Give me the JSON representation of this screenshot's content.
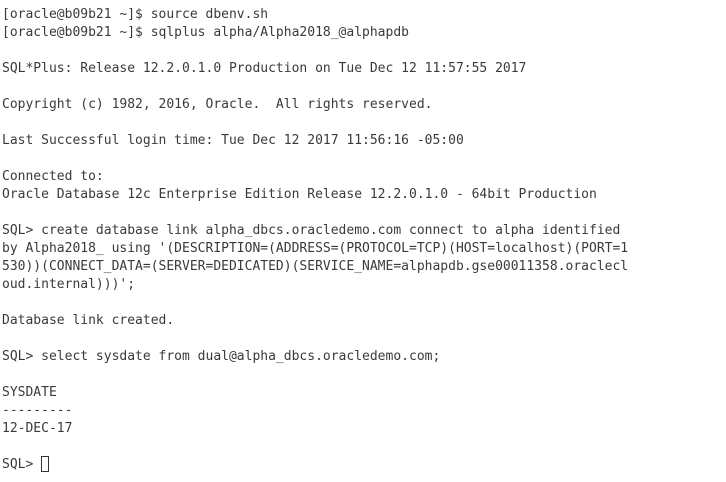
{
  "terminal": {
    "lines": [
      "[oracle@b09b21 ~]$ source dbenv.sh",
      "[oracle@b09b21 ~]$ sqlplus alpha/Alpha2018_@alphapdb",
      "",
      "SQL*Plus: Release 12.2.0.1.0 Production on Tue Dec 12 11:57:55 2017",
      "",
      "Copyright (c) 1982, 2016, Oracle.  All rights reserved.",
      "",
      "Last Successful login time: Tue Dec 12 2017 11:56:16 -05:00",
      "",
      "Connected to:",
      "Oracle Database 12c Enterprise Edition Release 12.2.0.1.0 - 64bit Production",
      "",
      "SQL> create database link alpha_dbcs.oracledemo.com connect to alpha identified",
      "by Alpha2018_ using '(DESCRIPTION=(ADDRESS=(PROTOCOL=TCP)(HOST=localhost)(PORT=1",
      "530))(CONNECT_DATA=(SERVER=DEDICATED)(SERVICE_NAME=alphapdb.gse00011358.oraclecl",
      "oud.internal)))';",
      "",
      "Database link created.",
      "",
      "SQL> select sysdate from dual@alpha_dbcs.oracledemo.com;",
      "",
      "SYSDATE",
      "---------",
      "12-DEC-17",
      "",
      "SQL> "
    ]
  }
}
